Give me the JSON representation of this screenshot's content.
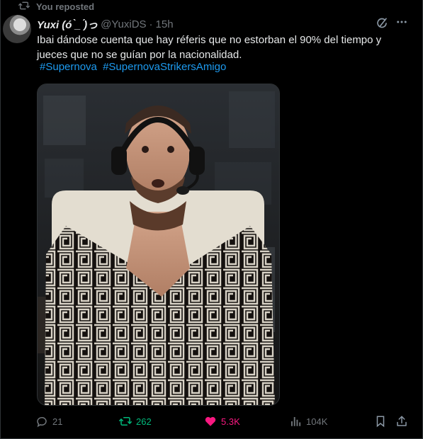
{
  "repost_banner": {
    "text": "You reposted",
    "icon": "retweet-icon"
  },
  "post": {
    "author_name": "Yuxi (ó ̀_ ́)っ",
    "handle": "@YuxiDS",
    "separator": "·",
    "time": "15h",
    "text": "Ibai dándose cuenta que hay réferis que no estorban el 90% del tiempo y jueces que no se guían por la nacionalidad.",
    "hashtags": [
      "#Supernova",
      "#SupernovaStrikersAmigo"
    ]
  },
  "actions": {
    "replies": "21",
    "reposts": "262",
    "likes": "5.3K",
    "views": "104K"
  },
  "colors": {
    "accent_blue": "#1d9bf0",
    "repost_green": "#00ba7c",
    "like_pink": "#f91880",
    "muted": "#71767b",
    "background": "#000000"
  }
}
